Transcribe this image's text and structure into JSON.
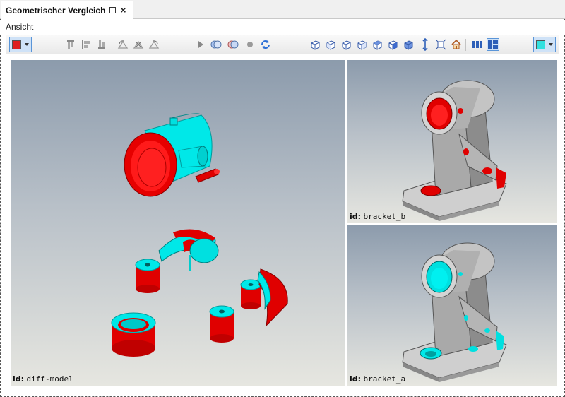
{
  "window": {
    "tab_title": "Geometrischer Vergleich",
    "restore_icon": "restore-window-icon",
    "close_label": "×"
  },
  "menu": {
    "items": [
      "Ansicht"
    ]
  },
  "toolbar": {
    "color_picker_1": "#e02020",
    "color_picker_2": "#33e0e0",
    "icons": [
      "align-top-icon",
      "align-middle-icon",
      "align-bottom-icon",
      "rotate-left-icon",
      "rotate-x-icon",
      "rotate-right-icon",
      "play-icon",
      "union-icon",
      "intersect-icon",
      "point-icon",
      "sync-icon",
      "view-iso-icon",
      "view-front-icon",
      "view-back-icon",
      "view-left-icon",
      "view-right-icon",
      "view-top-icon",
      "view-bottom-icon",
      "fit-height-icon",
      "fit-all-icon",
      "home-icon",
      "layout-columns-icon",
      "layout-grid-icon"
    ]
  },
  "viewports": {
    "main": {
      "label_key": "id:",
      "label_value": "diff-model"
    },
    "top": {
      "label_key": "id:",
      "label_value": "bracket_b"
    },
    "bottom": {
      "label_key": "id:",
      "label_value": "bracket_a"
    }
  },
  "colors": {
    "diff_removed": "#e00000",
    "diff_added": "#00e8e8",
    "model_grey": "#b8b8b8"
  }
}
